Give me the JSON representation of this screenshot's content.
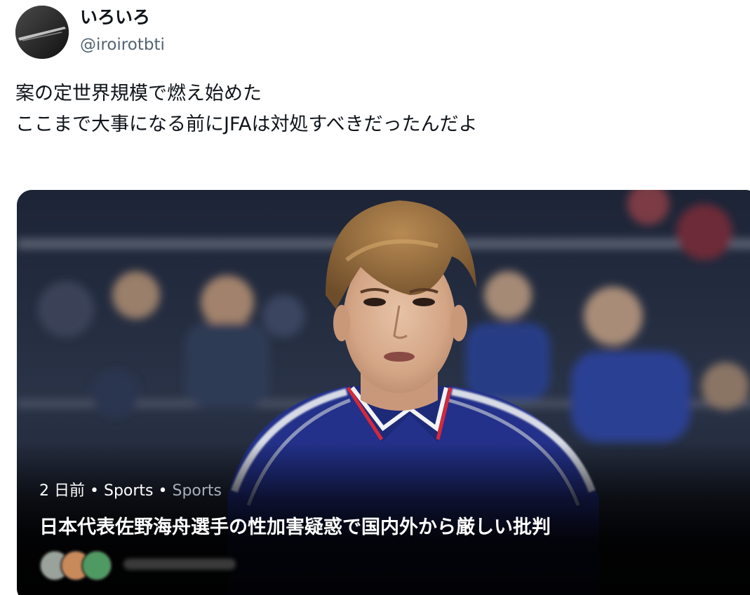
{
  "author": {
    "display_name": "いろいろ",
    "handle": "@iroirotbti"
  },
  "tweet": {
    "lines": [
      "案の定世界規模で燃え始めた",
      "ここまで大事になる前にJFAは対処すべきだったんだよ"
    ]
  },
  "card": {
    "time": "2 日前",
    "category": "Sports",
    "subcategory": "Sports",
    "separator": "•",
    "title": "日本代表佐野海舟選手の性加害疑惑で国内外から厳しい批判",
    "source_logos": [
      "#9aa39b",
      "#c98a5a",
      "#4f9a62"
    ]
  },
  "colors": {
    "text_primary": "#0f1419",
    "text_secondary": "#536471",
    "jersey_blue": "#23318a",
    "collar_red": "#d6283a"
  }
}
